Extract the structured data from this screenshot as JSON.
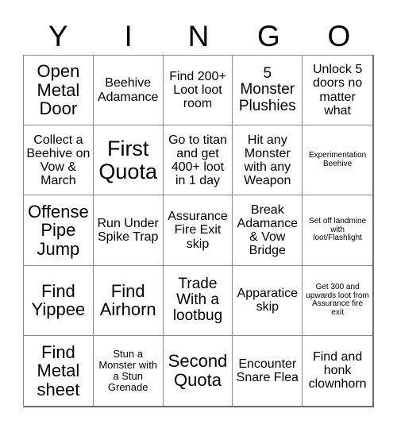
{
  "card": {
    "title_letters": [
      "Y",
      "I",
      "N",
      "G",
      "O"
    ],
    "grid_size": "5x5",
    "colors": {
      "text": "#000000",
      "background": "#ffffff",
      "grid_line": "#8a8a8a"
    },
    "cells": [
      {
        "text": "Open Metal Door",
        "size": "fs-xl"
      },
      {
        "text": "Beehive Adamance",
        "size": "fs-m"
      },
      {
        "text": "Find 200+ Loot loot room",
        "size": "fs-m"
      },
      {
        "text": "5 Monster Plushies",
        "size": "fs-l"
      },
      {
        "text": "Unlock 5 doors no matter what",
        "size": "fs-m"
      },
      {
        "text": "Collect a Beehive on Vow & March",
        "size": "fs-m"
      },
      {
        "text": "First Quota",
        "size": "fs-xxl"
      },
      {
        "text": "Go to titan and get 400+ loot in 1 day",
        "size": "fs-m"
      },
      {
        "text": "Hit any Monster with any Weapon",
        "size": "fs-m"
      },
      {
        "text": "Experimentation Beehive",
        "size": "fs-xs"
      },
      {
        "text": "Offense Pipe Jump",
        "size": "fs-xl"
      },
      {
        "text": "Run Under Spike Trap",
        "size": "fs-m"
      },
      {
        "text": "Assurance Fire Exit skip",
        "size": "fs-m"
      },
      {
        "text": "Break Adamance & Vow Bridge",
        "size": "fs-m"
      },
      {
        "text": "Set off landmine with loot/Flashlight",
        "size": "fs-xs"
      },
      {
        "text": "Find Yippee",
        "size": "fs-xl"
      },
      {
        "text": "Find Airhorn",
        "size": "fs-xl"
      },
      {
        "text": "Trade With a lootbug",
        "size": "fs-l"
      },
      {
        "text": "Apparatice skip",
        "size": "fs-m"
      },
      {
        "text": "Get 300 and upwards loot from Assurance fire exit",
        "size": "fs-xs"
      },
      {
        "text": "Find Metal sheet",
        "size": "fs-xl"
      },
      {
        "text": "Stun a Monster with a Stun Grenade",
        "size": "fs-s"
      },
      {
        "text": "Second Quota",
        "size": "fs-xl"
      },
      {
        "text": "Encounter Snare Flea",
        "size": "fs-m"
      },
      {
        "text": "Find and honk clownhorn",
        "size": "fs-m"
      }
    ]
  }
}
